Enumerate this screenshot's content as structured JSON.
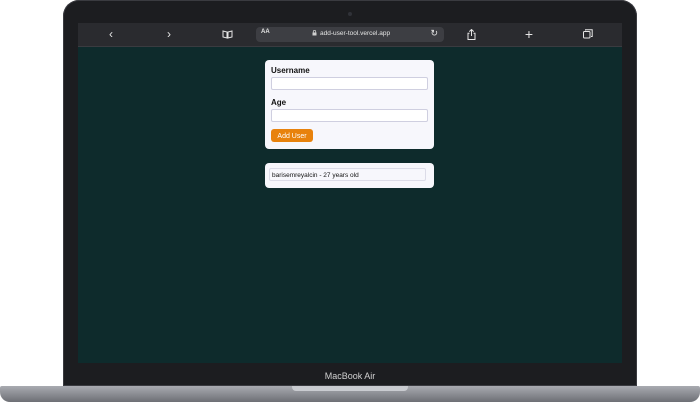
{
  "device": {
    "brand_label": "MacBook Air"
  },
  "browser": {
    "aa_label": "AA",
    "url": "add-user-tool.vercel.app",
    "icons": [
      "back-icon",
      "forward-icon",
      "book-icon",
      "lock-icon",
      "reload-icon",
      "share-icon",
      "plus-icon",
      "tabs-icon"
    ]
  },
  "form": {
    "username_label": "Username",
    "username_value": "",
    "age_label": "Age",
    "age_value": "",
    "submit_label": "Add User"
  },
  "users": [
    {
      "text": "barisemreyalcin - 27 years old"
    }
  ],
  "colors": {
    "page_background": "#0e2b2c",
    "card_background": "#f7f7fc",
    "button_accent": "#e8820c"
  }
}
